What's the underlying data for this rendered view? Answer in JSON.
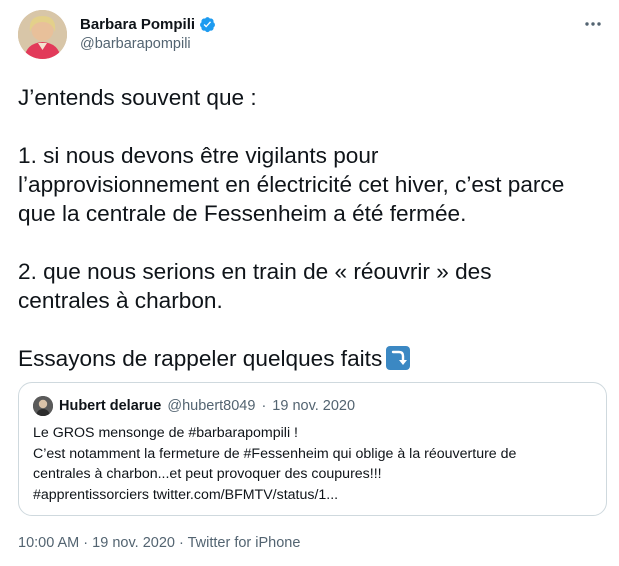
{
  "author": {
    "name": "Barbara Pompili",
    "handle": "@barbarapompili",
    "verified": true,
    "avatar_icon": "profile-photo"
  },
  "menu_icon": "more-horizontal-icon",
  "tweet": {
    "line1": "J’entends souvent que :",
    "point1_line1": "1. si nous devons être vigilants pour",
    "point1_line2": "l’approvisionnement en électricité cet hiver, c’est parce",
    "point1_line3": "que la centrale de Fessenheim a été fermée.",
    "point2_line1": "2. que nous serions en train de « réouvrir » des",
    "point2_line2": "centrales à charbon.",
    "closing": "Essayons de rappeler quelques faits",
    "closing_emoji": "right-arrow-curving-down-emoji"
  },
  "quoted_tweet": {
    "name": "Hubert delarue",
    "handle": "@hubert8049",
    "separator": "·",
    "date": "19 nov. 2020",
    "lines": [
      "Le GROS mensonge de #barbarapompili !",
      "C’est notamment la fermeture de #Fessenheim qui oblige à la réouverture de",
      "centrales à charbon...et peut provoquer des coupures!!!",
      "#apprentissorciers twitter.com/BFMTV/status/1..."
    ]
  },
  "footer": {
    "time": "10:00 AM",
    "separator": "·",
    "date": "19 nov. 2020",
    "source": "Twitter for iPhone"
  },
  "colors": {
    "text": "#0f1419",
    "secondary": "#536471",
    "verified_blue": "#1d9bf0",
    "border": "#cfd9de",
    "emoji_blue": "#3b88c3"
  }
}
